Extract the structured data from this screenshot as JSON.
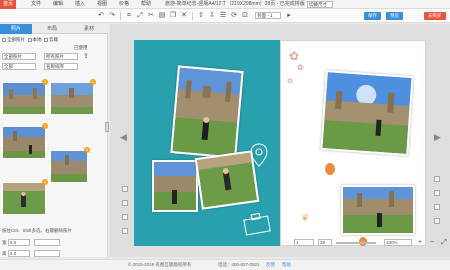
{
  "menubar": {
    "items": [
      "首页",
      "文件",
      "编辑",
      "插入",
      "视图",
      "价格",
      "帮助"
    ],
    "doc_title": "旅游-简单纪念-竖版A4/12寸（219X298mm）28页 - 已完成排版",
    "mode_value": "切换尺寸"
  },
  "toolbar": {
    "icons": [
      "undo-icon",
      "redo-icon",
      "crop-icon",
      "transform-icon",
      "cut-icon",
      "paste-icon",
      "copy-icon",
      "delete-icon",
      "layer-up-icon",
      "layer-down-icon",
      "align-icon",
      "rotate-icon",
      "lock-icon"
    ],
    "page_select": "封面 - 1",
    "save_label": "保存",
    "preview_label": "预览",
    "order_label": "去购买",
    "colors": {
      "save": "#3a8fd9",
      "preview": "#3a8fd9",
      "order": "#e9553c"
    }
  },
  "leftpanel": {
    "tabs": [
      "照片",
      "布局",
      "素材"
    ],
    "options_row1": [
      "全部照片",
      "本地",
      "云端"
    ],
    "options_row2": [
      "已使用"
    ],
    "album_label": "全部照片",
    "date_select": "所有照片",
    "sort_label": "全部",
    "sort_select": "名称排序",
    "thumb_badges": [
      "1",
      "1",
      "1",
      "1",
      "1"
    ],
    "hint": "按住Ctrl、Shift多选，右键删除照片",
    "field_w_label": "宽",
    "field_w_value": "8.0",
    "field_h_label": "高",
    "field_h_value": "6.0",
    "colors": {
      "active_tab": "#3a8fd9",
      "badge": "#f3a21b"
    }
  },
  "canvas": {
    "left_page_color": "#29a0ad",
    "right_page_color": "#ffffff"
  },
  "bottombar": {
    "page_input": "1",
    "zoom_select": "100%",
    "page_total": "28"
  },
  "footer": {
    "copyright": "© 2015-2018 有图互联版权所有",
    "phone": "电话：400-827-0521",
    "links": [
      "反馈",
      "帮助"
    ]
  }
}
